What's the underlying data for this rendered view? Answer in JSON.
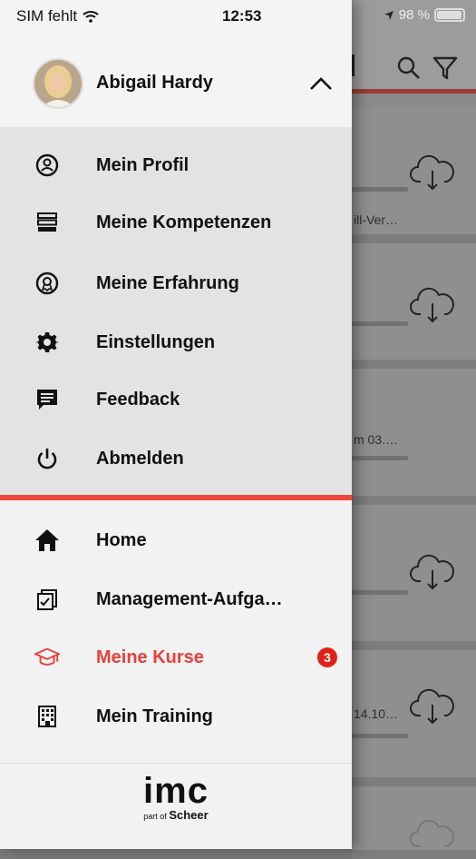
{
  "status_bar": {
    "carrier": "SIM fehlt",
    "time": "12:53",
    "battery": "98 %",
    "battery_level": 0.98
  },
  "user": {
    "name": "Abigail Hardy"
  },
  "profile_menu": [
    {
      "label": "Mein Profil",
      "icon": "profile-icon"
    },
    {
      "label": "Meine Kompetenzen",
      "icon": "competences-icon"
    },
    {
      "label": "Meine Erfahrung",
      "icon": "experience-icon"
    },
    {
      "label": "Einstellungen",
      "icon": "gear-icon"
    },
    {
      "label": "Feedback",
      "icon": "feedback-icon"
    },
    {
      "label": "Abmelden",
      "icon": "power-icon"
    }
  ],
  "nav_menu": [
    {
      "label": "Home",
      "icon": "home-icon"
    },
    {
      "label": "Management-Aufga…",
      "icon": "tasks-icon"
    },
    {
      "label": "Meine Kurse",
      "icon": "graduation-cap-icon",
      "active": true,
      "badge": "3"
    },
    {
      "label": "Mein Training",
      "icon": "building-icon"
    }
  ],
  "logo": {
    "main": "imc",
    "sub_prefix": "part of",
    "sub_brand": "Scheer"
  },
  "background": {
    "snippets": [
      "ill-Ver…",
      "m 03.…",
      "14.10…"
    ]
  },
  "colors": {
    "accent": "#f0473a",
    "active_text": "#e8403a",
    "badge": "#e0201a"
  }
}
